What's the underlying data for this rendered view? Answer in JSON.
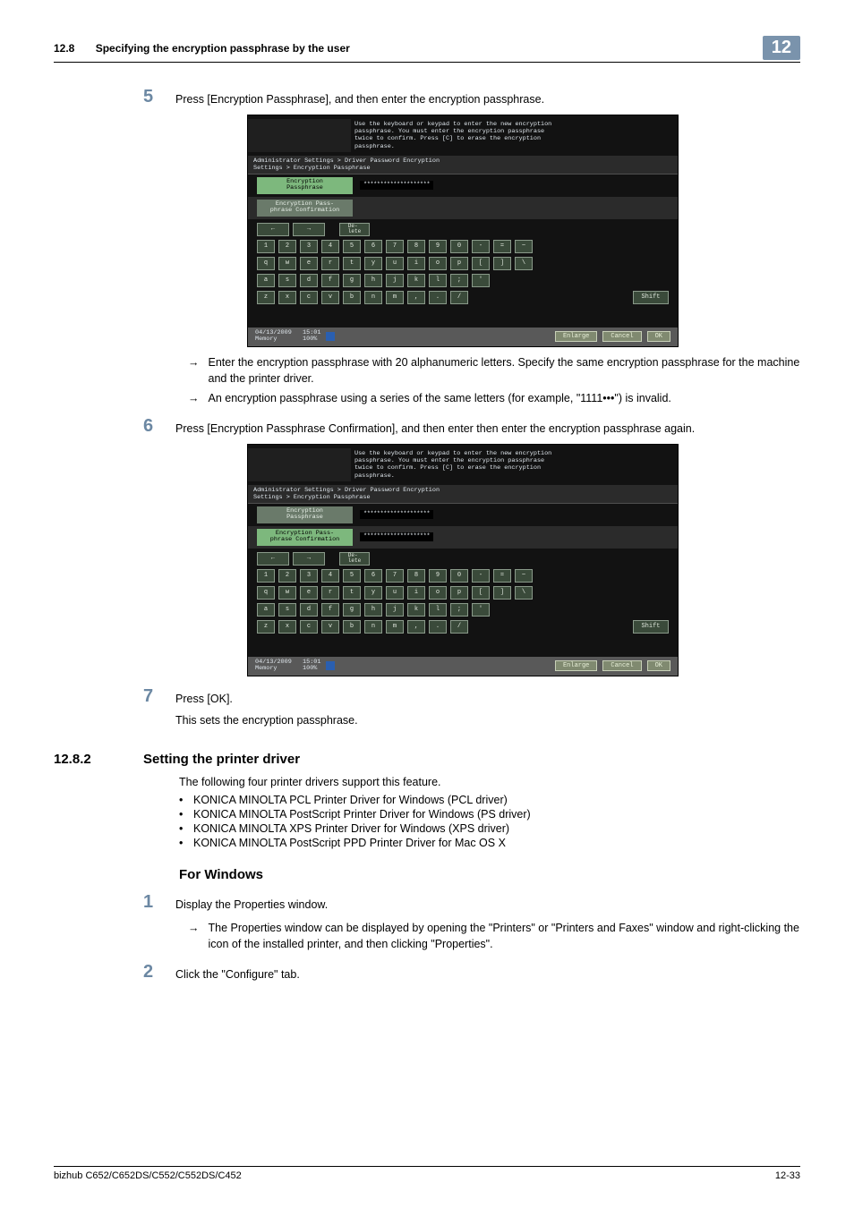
{
  "header": {
    "section_num": "12.8",
    "section_title": "Specifying the encryption passphrase by the user",
    "badge": "12"
  },
  "step5": {
    "num": "5",
    "text": "Press [Encryption Passphrase], and then enter the encryption passphrase."
  },
  "screenshot1": {
    "msg_l1": "Use the keyboard or keypad to enter the new encryption",
    "msg_l2": "passphrase. You must enter the encryption passphrase",
    "msg_l3": "twice to confirm. Press [C] to erase the encryption",
    "msg_l4": "passphrase.",
    "breadcrumb": "Administrator Settings > Driver Password Encryption\nSettings > Encryption Passphrase",
    "field1_label": "Encryption\nPassphrase",
    "field1_value": "********************",
    "field2_label": "Encryption Pass-\nphrase Confirmation",
    "field2_value": "",
    "delete_label": "De-\nlete",
    "kb_row1": [
      "1",
      "2",
      "3",
      "4",
      "5",
      "6",
      "7",
      "8",
      "9",
      "0",
      "-",
      "=",
      "~"
    ],
    "kb_row2": [
      "q",
      "w",
      "e",
      "r",
      "t",
      "y",
      "u",
      "i",
      "o",
      "p",
      "[",
      "]",
      "\\"
    ],
    "kb_row3": [
      "a",
      "s",
      "d",
      "f",
      "g",
      "h",
      "j",
      "k",
      "l",
      ";",
      "'"
    ],
    "kb_row4": [
      "z",
      "x",
      "c",
      "v",
      "b",
      "n",
      "m",
      ",",
      ".",
      "/"
    ],
    "shift": "Shift",
    "footer_date": "04/13/2009",
    "footer_time": "15:01",
    "footer_mem": "Memory",
    "footer_pct": "100%",
    "footer_enlarge": "Enlarge",
    "footer_cancel": "Cancel",
    "footer_ok": "OK"
  },
  "step5_bullets": {
    "b1": "Enter the encryption passphrase with 20 alphanumeric letters. Specify the same encryption passphrase for the machine and the printer driver.",
    "b2": "An encryption passphrase using a series of the same letters (for example, \"1111•••\") is invalid."
  },
  "step6": {
    "num": "6",
    "text": "Press [Encryption Passphrase Confirmation], and then enter then enter the encryption passphrase again."
  },
  "screenshot2": {
    "field2_highlight": true,
    "field2_value": "********************"
  },
  "step7": {
    "num": "7",
    "text1": "Press [OK].",
    "text2": "This sets the encryption passphrase."
  },
  "section_1282": {
    "num": "12.8.2",
    "title": "Setting the printer driver",
    "lead": "The following four printer drivers support this feature.",
    "drivers": [
      "KONICA MINOLTA PCL Printer Driver for Windows (PCL driver)",
      "KONICA MINOLTA PostScript Printer Driver for Windows (PS driver)",
      "KONICA MINOLTA XPS Printer Driver for Windows (XPS driver)",
      "KONICA MINOLTA PostScript PPD Printer Driver for Mac OS X"
    ]
  },
  "for_windows": {
    "title": "For Windows",
    "step1_num": "1",
    "step1_text": "Display the Properties window.",
    "step1_bullet": "The Properties window can be displayed by opening the \"Printers\" or \"Printers and Faxes\" window and right-clicking the icon of the installed printer, and then clicking \"Properties\".",
    "step2_num": "2",
    "step2_text": "Click the \"Configure\" tab."
  },
  "footer": {
    "left": "bizhub C652/C652DS/C552/C552DS/C452",
    "right": "12-33"
  }
}
